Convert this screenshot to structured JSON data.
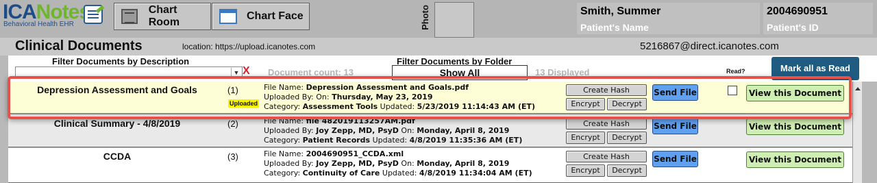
{
  "header": {
    "logo": {
      "brand_a": "ICA",
      "brand_b": "Notes",
      "tagline": "Behavioral Health EHR"
    },
    "chart_room_label": "Chart Room",
    "chart_face_label": "Chart Face",
    "photo_label": "Photo",
    "patient_name": "Smith, Summer",
    "patient_name_caption": "Patient's Name",
    "patient_id": "2004690951",
    "patient_id_caption": "Patient's ID"
  },
  "section": {
    "title": "Clinical Documents",
    "location": "location: https://upload.icanotes.com",
    "email": "5216867@direct.icanotes.com"
  },
  "filters": {
    "description_label": "Filter Documents by Description",
    "description_value": "",
    "clear_label": "X",
    "document_count": "Document count: 13",
    "folder_label": "Filter Documents by Folder",
    "folder_value": "Show All",
    "displayed": "13 Displayed",
    "read_label": "Read?",
    "mark_all_label": "Mark all as Read"
  },
  "buttons": {
    "create_hash": "Create Hash",
    "encrypt": "Encrypt",
    "decrypt": "Decrypt",
    "send_file": "Send File",
    "view": "View this Document"
  },
  "documents": [
    {
      "title": "Depression Assessment and Goals",
      "number": "(1)",
      "badge": "Uploaded",
      "file_name_label": "File Name:",
      "file_name": "Depression Assessment and Goals.pdf",
      "uploaded_by_label": "Uploaded By:",
      "uploaded_by": "",
      "on_label": "On:",
      "uploaded_on": "Thursday, May 23, 2019",
      "category_label": "Category:",
      "category": "Assessment Tools",
      "updated_label": "Updated:",
      "updated": "5/23/2019 11:14:43 AM (ET)"
    },
    {
      "title": "Clinical Summary - 4/8/2019",
      "number": "(2)",
      "file_name_label": "File Name:",
      "file_name": "file 482019113257AM.pdf",
      "uploaded_by_label": "Uploaded By:",
      "uploaded_by": "Joy Zepp, MD, PsyD",
      "on_label": "On:",
      "uploaded_on": "Monday, April 8, 2019",
      "category_label": "Category:",
      "category": "Patient Records",
      "updated_label": "Updated:",
      "updated": "4/8/2019 11:35:36 AM (ET)"
    },
    {
      "title": "CCDA",
      "number": "(3)",
      "file_name_label": "File Name:",
      "file_name": "2004690951_CCDA.xml",
      "uploaded_by_label": "Uploaded By:",
      "uploaded_by": "Joy Zepp, MD, PsyD",
      "on_label": "On:",
      "uploaded_on": "Monday, April 8, 2019",
      "category_label": "Category:",
      "category": "Continuity of Care",
      "updated_label": "Updated:",
      "updated": "4/8/2019 11:34:04 AM (ET)"
    }
  ],
  "colors": {
    "highlight_frame": "#e8514a",
    "send_button": "#5fa0f1",
    "view_button": "#cfeeb1",
    "mark_all_button": "#205b82"
  }
}
